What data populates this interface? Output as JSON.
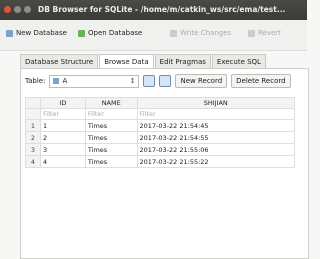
{
  "window": {
    "title": "DB Browser for SQLite - /home/m/catkin_ws/src/ema/test..."
  },
  "toolbar": {
    "new_db": "New Database",
    "open_db": "Open Database",
    "write": "Write Changes",
    "revert": "Revert"
  },
  "tabs": [
    "Database Structure",
    "Browse Data",
    "Edit Pragmas",
    "Execute SQL"
  ],
  "browse": {
    "table_label": "Table:",
    "table_value": "A",
    "new_record": "New Record",
    "delete_record": "Delete Record",
    "columns": [
      "ID",
      "NAME",
      "SHIJIAN"
    ],
    "filter_placeholder": "Filter",
    "rows": [
      {
        "rn": "1",
        "id": "1",
        "name": "Times",
        "time": "2017-03-22 21:54:45"
      },
      {
        "rn": "2",
        "id": "2",
        "name": "Times",
        "time": "2017-03-22 21:54:55"
      },
      {
        "rn": "3",
        "id": "3",
        "name": "Times",
        "time": "2017-03-22 21:55:06"
      },
      {
        "rn": "4",
        "id": "4",
        "name": "Times",
        "time": "2017-03-22 21:55:22"
      }
    ]
  },
  "colors": {
    "titlebar": "#3c3c3a",
    "close": "#e0533d"
  }
}
